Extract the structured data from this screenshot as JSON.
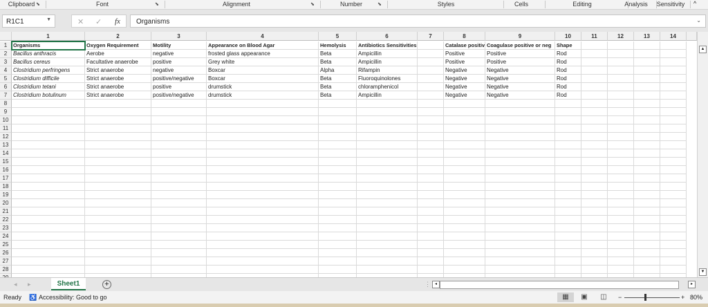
{
  "ribbon": {
    "groups": [
      "Clipboard",
      "Font",
      "Alignment",
      "Number",
      "Styles",
      "Cells",
      "Editing",
      "Analysis",
      "Sensitivity"
    ]
  },
  "formula_bar": {
    "name_box": "R1C1",
    "cancel": "✕",
    "enter": "✓",
    "fx": "fx",
    "value": "Organisms"
  },
  "columns": [
    "1",
    "2",
    "3",
    "4",
    "5",
    "6",
    "7",
    "8",
    "9",
    "10",
    "11",
    "12",
    "13",
    "14"
  ],
  "row_count": 29,
  "rows": [
    [
      "Organisms",
      "Oxygen Requirement",
      "Motility",
      "Appearance on Blood Agar",
      "Hemolysis",
      "Antibiotics Sensitivities",
      "",
      "Catalase positive",
      "Coagulase positive or neg",
      "Shape"
    ],
    [
      "Bacillus anthracis",
      "Aerobe",
      "negative",
      "frosted glass appearance",
      "Beta",
      "Ampicillin",
      "",
      "Positive",
      "Positive",
      "Rod"
    ],
    [
      "Bacillus cereus",
      "Facultative anaerobe",
      "positive",
      "Grey white",
      "Beta",
      "Ampicillin",
      "",
      "Positive",
      "Positive",
      "Rod"
    ],
    [
      "Clostridium perfringens",
      "Strict anaerobe",
      "negative",
      "Boxcar",
      "Alpha",
      "Rifampin",
      "",
      "Negative",
      "Negative",
      "Rod"
    ],
    [
      "Clostridium difficile",
      "Strict anaerobe",
      "positive/negative",
      "Boxcar",
      "Beta",
      "Fluoroquinolones",
      "",
      "Negative",
      "Negative",
      "Rod"
    ],
    [
      "Clostridium tetani",
      "Strict anaerobe",
      "positive",
      "drumstick",
      "Beta",
      "chloramphenicol",
      "",
      "Negative",
      "Negative",
      "Rod"
    ],
    [
      "Clostridium botulinum",
      "Strict anaerobe",
      "positive/negative",
      "drumstick",
      "Beta",
      "Ampicillin",
      "",
      "Negative",
      "Negative",
      "Rod"
    ]
  ],
  "sheet_tab": "Sheet1",
  "add_sheet": "+",
  "status": {
    "ready": "Ready",
    "accessibility": "Accessibility: Good to go",
    "zoom": "80%"
  },
  "colors": {
    "accent": "#217346"
  }
}
